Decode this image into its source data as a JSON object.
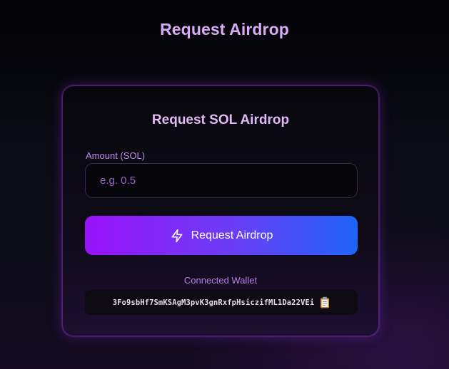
{
  "page": {
    "title": "Request Airdrop"
  },
  "card": {
    "title": "Request SOL Airdrop",
    "amount_label": "Amount (SOL)",
    "amount_placeholder": "e.g. 0.5",
    "amount_value": "",
    "button_label": "Request Airdrop",
    "button_icon": "bolt-icon",
    "wallet_label": "Connected Wallet",
    "wallet_address": "3Fo9sbHf7SmKSAgM3pvK3gnRxfpHsiczifML1Da22VEi",
    "copy_icon": "clipboard-icon"
  },
  "colors": {
    "title": "#d9aaf5",
    "accent_purple": "#9812f9",
    "accent_blue": "#1f64fb",
    "card_border": "#8a3ad6",
    "label": "#c38be8"
  }
}
